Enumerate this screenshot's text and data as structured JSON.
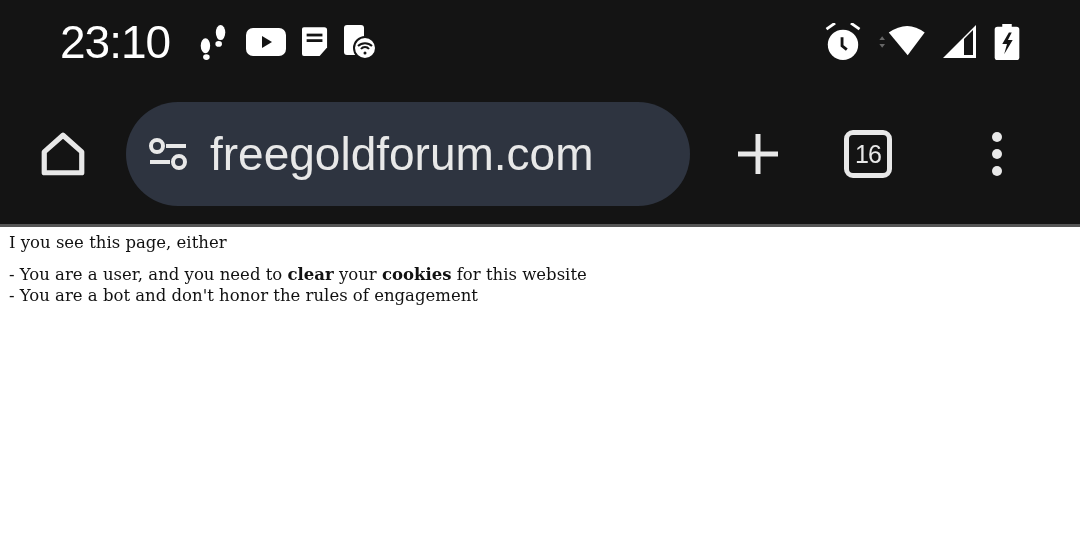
{
  "status_bar": {
    "time": "23:10"
  },
  "toolbar": {
    "url": "freegoldforum.com",
    "tab_count": "16"
  },
  "page": {
    "intro": "I you see this page, either",
    "lines": [
      "- You are a user, and you need to **clear** your **cookies** for this website",
      "- You are a bot and don't honor the rules of engagement"
    ]
  }
}
